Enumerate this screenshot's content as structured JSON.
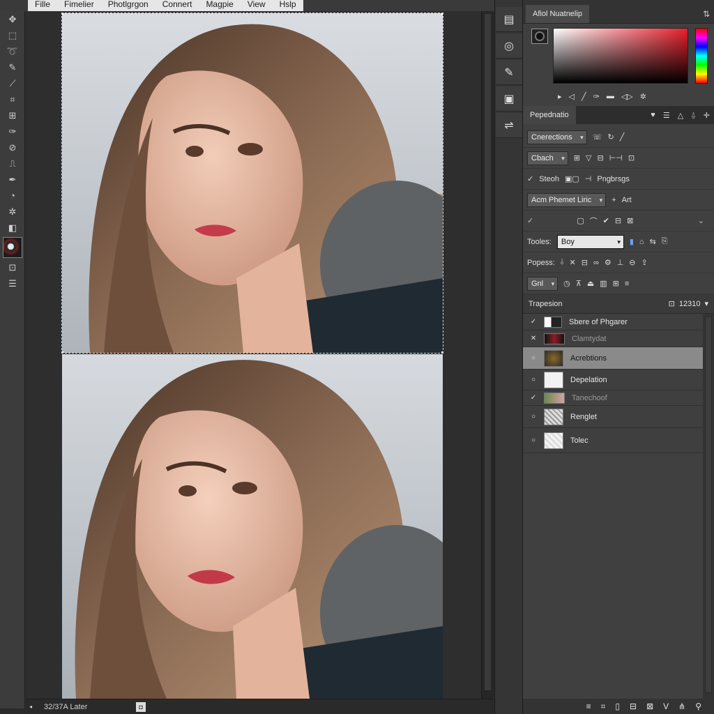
{
  "menu": {
    "items": [
      "Fille",
      "Fimelier",
      "Photlgrgon",
      "Connert",
      "Magpie",
      "View",
      "Hslp"
    ]
  },
  "toolbar": {
    "tools": [
      "move-tool",
      "marquee-tool",
      "lasso-tool",
      "brush-tool",
      "wand-tool",
      "crop-tool",
      "frame-tool",
      "eyedropper-tool",
      "heal-tool",
      "clone-tool",
      "pen-tool",
      "blur-tool",
      "dodge-tool"
    ],
    "bottom_tools": [
      "type-tool",
      "shape-tool"
    ]
  },
  "status": {
    "doc_info": "32/37A Later"
  },
  "midcol": {
    "buttons": [
      "layers-icon",
      "history-icon",
      "tools-icon",
      "lock-icon",
      "adjust-icon"
    ]
  },
  "panel": {
    "color_tab": "Afiol Nuatnelip",
    "properties_tab": "Pepednatio",
    "row1": {
      "select": "Cnerections"
    },
    "row2": {
      "select": "Cbach"
    },
    "row3": {
      "label": "Steoh",
      "extra": "Pngbrsgs"
    },
    "row4": {
      "label": "Acm Phemet Liric",
      "extra": "Art"
    },
    "row6": {
      "label": "Tooles:",
      "select": "Boy"
    },
    "row7": {
      "label": "Popess:"
    },
    "row8": {
      "select": "Gnl"
    },
    "layers_title": "Trapesion",
    "layers_value": "12310",
    "layers": [
      {
        "name": "Sbere of Phgarer",
        "visible_mark": "✓"
      },
      {
        "name": "Clamtydat",
        "visible_mark": "✕"
      },
      {
        "name": "Acrebtions",
        "visible_mark": "○"
      },
      {
        "name": "Depelation",
        "visible_mark": "○"
      },
      {
        "name": "Tanechoof",
        "visible_mark": "✓"
      },
      {
        "name": "Renglet",
        "visible_mark": "○"
      },
      {
        "name": "Tolec",
        "visible_mark": "○"
      }
    ]
  }
}
